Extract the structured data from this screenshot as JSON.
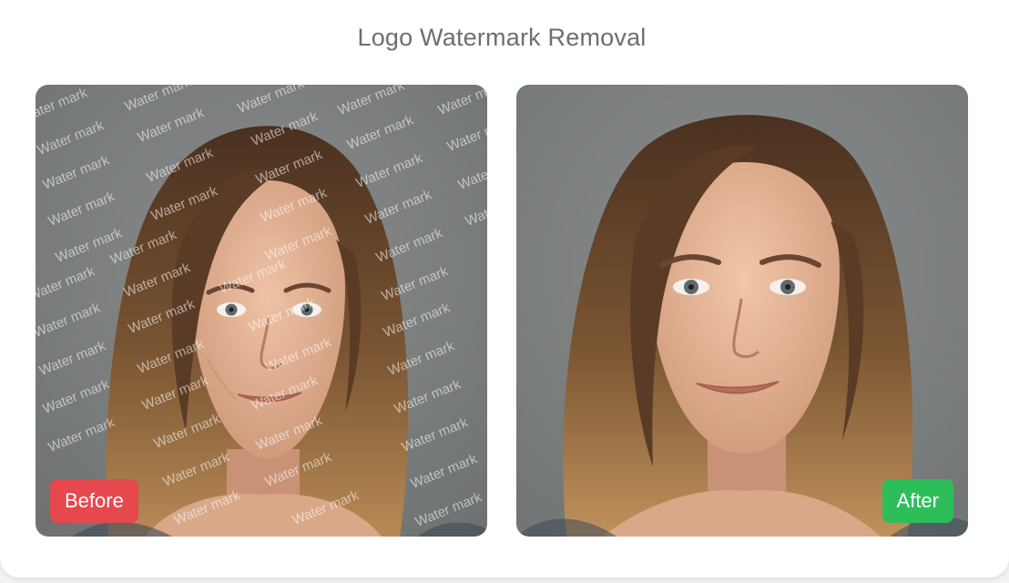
{
  "title": "Logo Watermark Removal",
  "before": {
    "badge": "Before",
    "badge_color": "#e5484d"
  },
  "after": {
    "badge": "After",
    "badge_color": "#2dbe5a"
  },
  "watermark": {
    "text": "Water mark"
  },
  "colors": {
    "background": "#ffffff",
    "studio_backdrop": "#7f8282",
    "hair": "#6b4a30",
    "skin": "#e7b79c"
  }
}
